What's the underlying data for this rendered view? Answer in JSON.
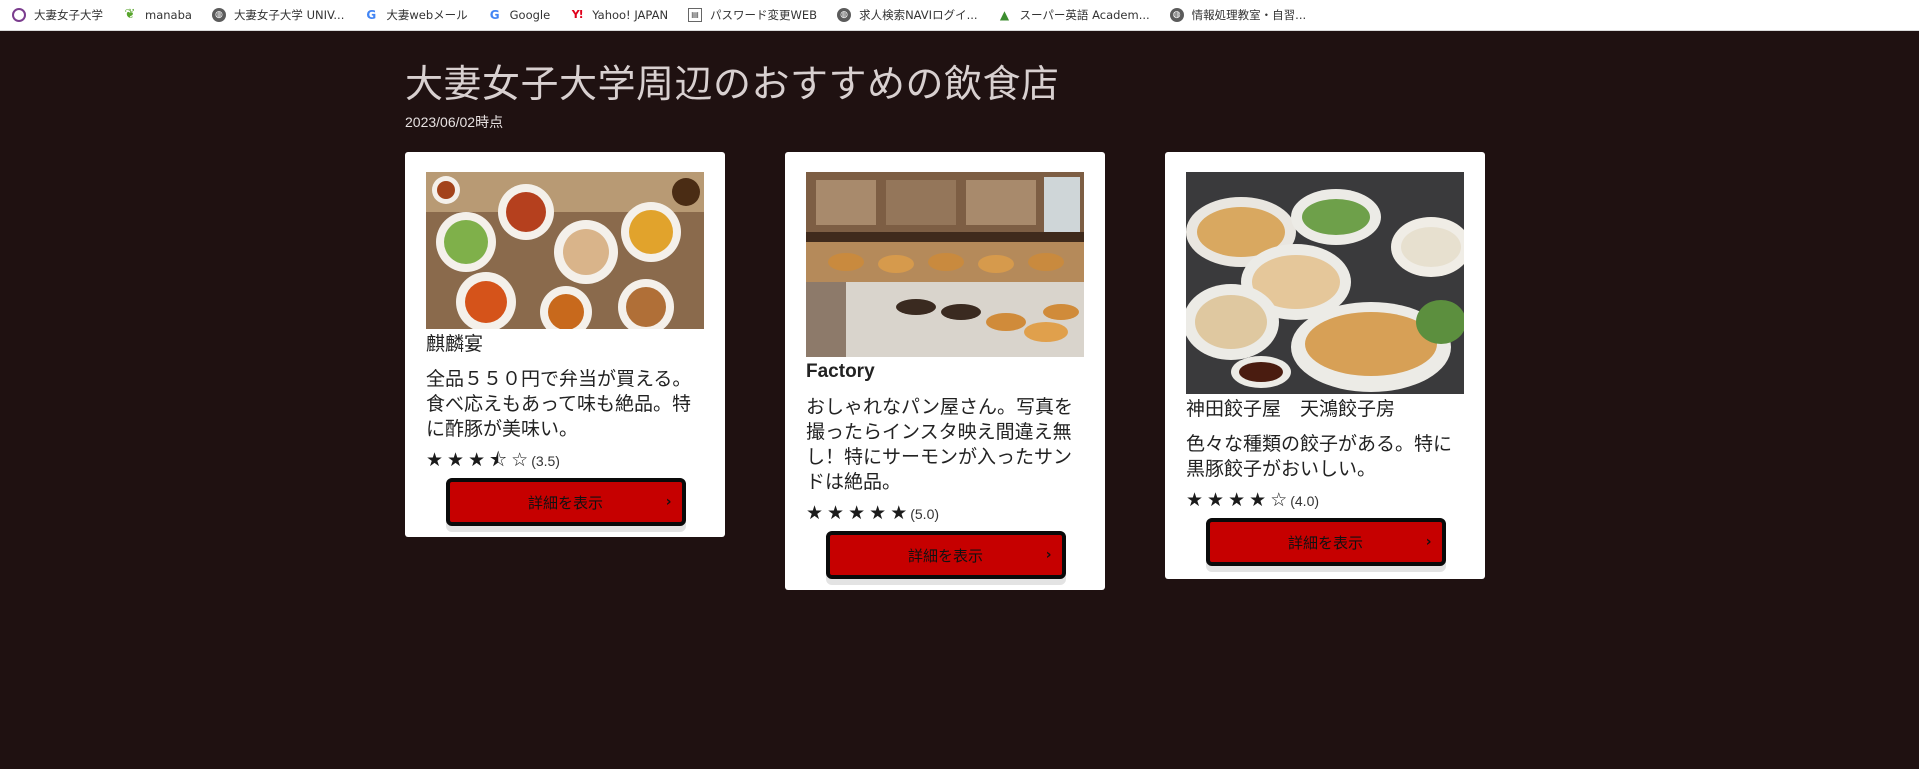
{
  "bookmarks": [
    {
      "label": "大妻女子大学",
      "icon": "otsuma-icon"
    },
    {
      "label": "manaba",
      "icon": "leaf-icon"
    },
    {
      "label": "大妻女子大学 UNIV...",
      "icon": "globe-icon"
    },
    {
      "label": "大妻webメール",
      "icon": "google-icon"
    },
    {
      "label": "Google",
      "icon": "google-icon"
    },
    {
      "label": "Yahoo! JAPAN",
      "icon": "yahoo-icon"
    },
    {
      "label": "パスワード変更WEB",
      "icon": "page-icon"
    },
    {
      "label": "求人検索NAVIログイ...",
      "icon": "globe-icon"
    },
    {
      "label": "スーパー英語 Academ...",
      "icon": "lock-icon"
    },
    {
      "label": "情報処理教室・自習...",
      "icon": "globe-icon"
    }
  ],
  "page": {
    "title": "大妻女子大学周辺のおすすめの飲食店",
    "date": "2023/06/02時点"
  },
  "cards": [
    {
      "name": "麒麟宴",
      "description": "全品５５０円で弁当が買える。食べ応えもあって味も絶品。特に酢豚が美味い。",
      "rating_text": "(3.5)",
      "rating": 3.5,
      "button_label": "詳細を表示"
    },
    {
      "name": "Factory",
      "description": "おしゃれなパン屋さん。写真を撮ったらインスタ映え間違え無し！特にサーモンが入ったサンドは絶品。",
      "rating_text": "(5.0)",
      "rating": 5.0,
      "button_label": "詳細を表示"
    },
    {
      "name": "神田餃子屋　天鴻餃子房",
      "description": "色々な種類の餃子がある。特に黒豚餃子がおいしい。",
      "rating_text": "(4.0)",
      "rating": 4.0,
      "button_label": "詳細を表示"
    }
  ],
  "colors": {
    "background": "#1f1111",
    "button": "#c60000",
    "card": "#ffffff"
  }
}
